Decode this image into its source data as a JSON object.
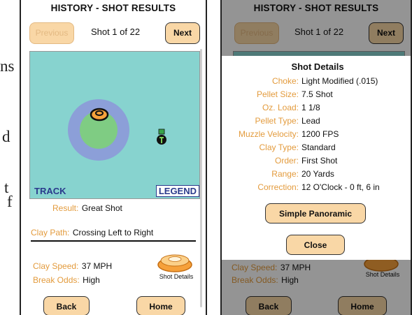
{
  "backdrop_text": [
    "ns",
    "d",
    "t",
    "f"
  ],
  "left_phone": {
    "title": "HISTORY - SHOT RESULTS",
    "nav": {
      "previous_label": "Previous",
      "shot_counter": "Shot 1 of 22",
      "next_label": "Next"
    },
    "field": {
      "track_label": "TRACK",
      "legend_label": "LEGEND",
      "colors": {
        "background": "#87d3cf",
        "outer_ring": "#8c9fd8",
        "inner_ring": "#7fcc83",
        "clay": "#f6a13b",
        "shooter": "#1f7d2a"
      }
    },
    "result": {
      "label": "Result:",
      "value": "Great Shot"
    },
    "clay_path": {
      "label": "Clay Path:",
      "value": "Crossing Left to Right"
    },
    "clay_speed": {
      "label": "Clay Speed:",
      "value": "37 MPH"
    },
    "break_odds": {
      "label": "Break Odds:",
      "value": "High"
    },
    "shot_details_label": "Shot Details",
    "back_label": "Back",
    "home_label": "Home"
  },
  "right_phone": {
    "title": "HISTORY - SHOT RESULTS",
    "nav": {
      "previous_label": "Previous",
      "shot_counter": "Shot 1 of 22",
      "next_label": "Next"
    },
    "background_rows": {
      "clay_speed": {
        "label": "Clay Speed:",
        "value": "37 MPH"
      },
      "break_odds": {
        "label": "Break Odds:",
        "value": "High"
      },
      "shot_details_label": "Shot Details",
      "back_label": "Back",
      "home_label": "Home"
    },
    "modal": {
      "title": "Shot Details",
      "rows": [
        {
          "label": "Choke:",
          "value": "Light Modified (.015)"
        },
        {
          "label": "Pellet Size:",
          "value": "7.5 Shot"
        },
        {
          "label": "Oz. Load:",
          "value": "1 1/8"
        },
        {
          "label": "Pellet Type:",
          "value": "Lead"
        },
        {
          "label": "Muzzle Velocity:",
          "value": "1200 FPS"
        },
        {
          "label": "Clay Type:",
          "value": "Standard"
        },
        {
          "label": "Order:",
          "value": "First Shot"
        },
        {
          "label": "Range:",
          "value": "20 Yards"
        },
        {
          "label": "Correction:",
          "value": "12 O'Clock - 0 ft, 6 in"
        }
      ],
      "simple_panoramic_label": "Simple Panoramic",
      "close_label": "Close"
    }
  },
  "colors": {
    "accent_orange": "#e39b3d",
    "button_fill": "#f9d7a6",
    "overlay": "rgba(0,0,0,0.42)"
  }
}
